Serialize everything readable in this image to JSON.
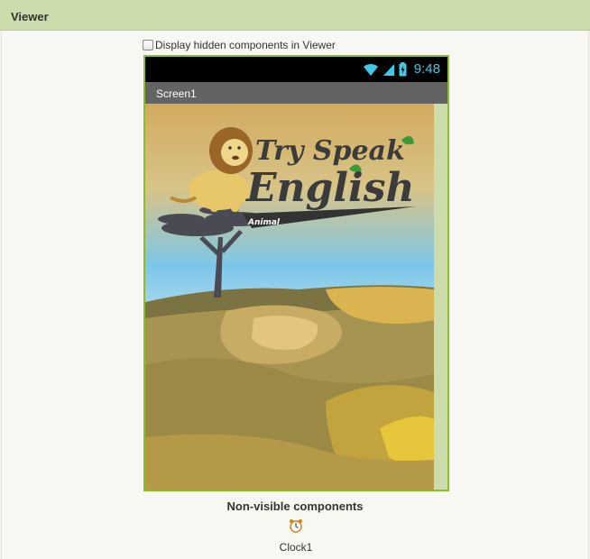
{
  "panel": {
    "title": "Viewer"
  },
  "hidden_components": {
    "label": "Display hidden components in Viewer",
    "checked": false
  },
  "phone": {
    "status_time": "9:48",
    "screen_title": "Screen1",
    "splash": {
      "line1": "Try Speak",
      "line2": "English",
      "ribbon": "Animal"
    }
  },
  "non_visible": {
    "title": "Non-visible components",
    "items": [
      {
        "label": "Clock1",
        "icon": "clock-icon"
      }
    ]
  },
  "colors": {
    "header_bg": "#cddcab",
    "phone_border": "#8cbf26",
    "status_time": "#41c8e8",
    "titlebar_bg": "#636363"
  }
}
